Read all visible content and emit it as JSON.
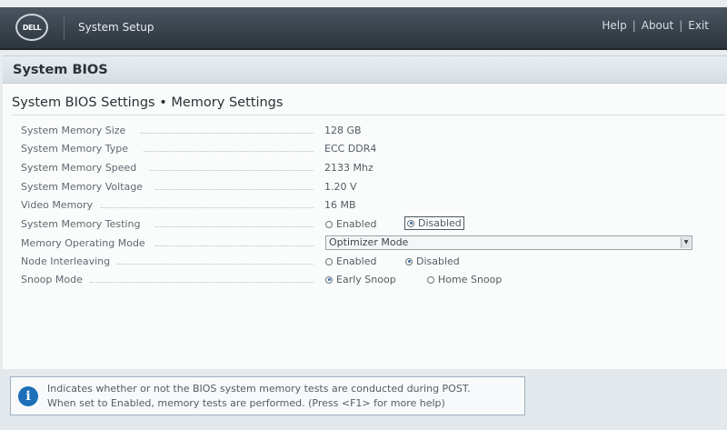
{
  "header": {
    "logo_text": "DELL",
    "title": "System Setup",
    "links": [
      "Help",
      "About",
      "Exit"
    ]
  },
  "panel": {
    "title": "System BIOS",
    "subtitle": "System BIOS Settings • Memory Settings"
  },
  "settings": {
    "memory_size": {
      "label": "System Memory Size",
      "value": "128 GB"
    },
    "memory_type": {
      "label": "System Memory Type",
      "value": "ECC DDR4"
    },
    "memory_speed": {
      "label": "System Memory Speed",
      "value": "2133 Mhz"
    },
    "memory_voltage": {
      "label": "System Memory Voltage",
      "value": "1.20 V"
    },
    "video_memory": {
      "label": "Video Memory",
      "value": "16 MB"
    },
    "memory_testing": {
      "label": "System Memory Testing",
      "options": [
        "Enabled",
        "Disabled"
      ],
      "selected": "Disabled"
    },
    "operating_mode": {
      "label": "Memory Operating Mode",
      "value": "Optimizer Mode"
    },
    "node_interleaving": {
      "label": "Node Interleaving",
      "options": [
        "Enabled",
        "Disabled"
      ],
      "selected": "Disabled"
    },
    "snoop_mode": {
      "label": "Snoop Mode",
      "options": [
        "Early Snoop",
        "Home Snoop"
      ],
      "selected": "Early Snoop"
    }
  },
  "help": {
    "icon": "info-icon",
    "line1": "Indicates whether or not the BIOS system memory tests are conducted during POST.",
    "line2": "When set to Enabled, memory tests are performed. (Press <F1> for more help)"
  }
}
